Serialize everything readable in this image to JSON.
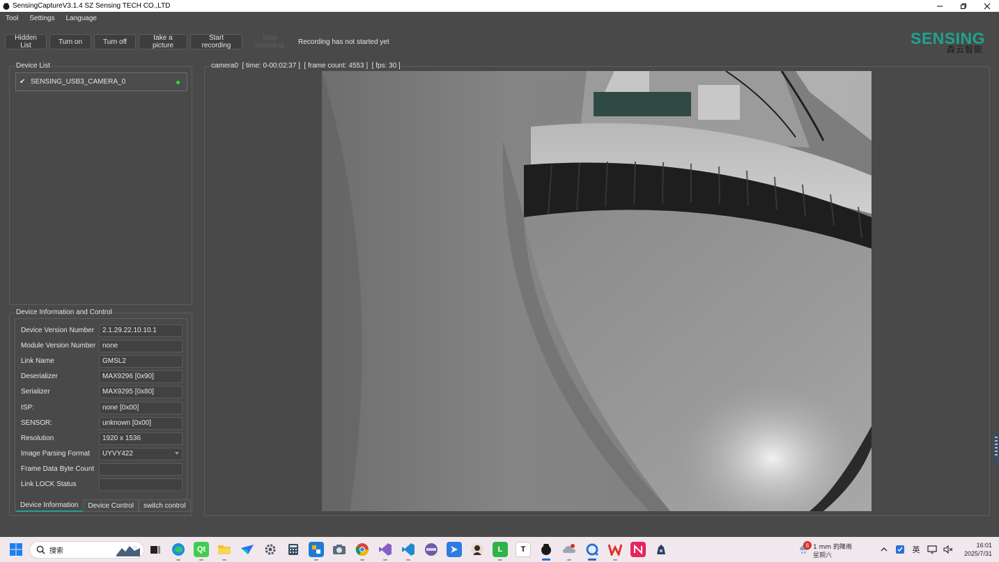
{
  "window": {
    "title": "SensingCaptureV3.1.4 SZ Sensing TECH CO.,LTD",
    "controls": [
      "minimize",
      "restore",
      "close"
    ]
  },
  "menu": [
    "Tool",
    "Settings",
    "Language"
  ],
  "toolbar": {
    "hidden_list": "Hidden List",
    "turn_on": "Turn on",
    "turn_off": "Turn off",
    "take_picture": "take a picture",
    "start_recording": "Start recording",
    "stop_recording": "Stop recording",
    "recording_status": "Recording has not started yet"
  },
  "logo": {
    "main": "SENSING",
    "sub": "森云智能",
    "color": "#1ea38f"
  },
  "device_list": {
    "title": "Device List",
    "items": [
      {
        "name": "SENSING_USB3_CAMERA_0",
        "checked": true,
        "status_color": "#2fe02f"
      }
    ]
  },
  "device_info": {
    "title": "Device Information and Control",
    "rows": [
      {
        "label": "Device Version Number",
        "value": "2.1.29.22.10.10.1"
      },
      {
        "label": "Module Version Number",
        "value": "none"
      },
      {
        "label": "Link Name",
        "value": "GMSL2"
      },
      {
        "label": "Deserializer",
        "value": "MAX9296 [0x90]"
      },
      {
        "label": "Serializer",
        "value": "MAX9295 [0x80]"
      },
      {
        "label": "ISP:",
        "value": "none [0x00]"
      },
      {
        "label": "SENSOR:",
        "value": "unknown [0x00]"
      },
      {
        "label": "Resolution",
        "value": "1920 x 1536"
      },
      {
        "label": "Image Parsing Format",
        "value": "UYVY422"
      },
      {
        "label": "Frame Data Byte Count",
        "value": ""
      },
      {
        "label": "Link LOCK Status",
        "value": ""
      }
    ],
    "tabs": [
      "Device Information",
      "Device Control",
      "switch control"
    ],
    "active_tab": "Device Information"
  },
  "camera": {
    "header": "camera0  [ time: 0-00:02:37 ]  [ frame count: 4553 ]  [ fps: 30 ]"
  },
  "taskbar": {
    "search_placeholder": "搜索",
    "apps": [
      "task-view",
      "edge",
      "qt-creator",
      "file-explorer",
      "feishu",
      "settings",
      "calculator",
      "app-store",
      "camera-app",
      "chrome",
      "visual-studio",
      "vscode",
      "app-purple",
      "app-blue-arrow",
      "app-avatar",
      "app-green-l",
      "typora",
      "sensingcapture",
      "app-cloud",
      "app-loop",
      "wps",
      "app-pink",
      "app-dark"
    ],
    "weather": {
      "badge": "6",
      "line1": "1 mm 的降雨",
      "line2": "星期六"
    },
    "tray": {
      "ime": "英"
    },
    "clock": {
      "time": "16:01",
      "date": "2025/7/31"
    }
  }
}
